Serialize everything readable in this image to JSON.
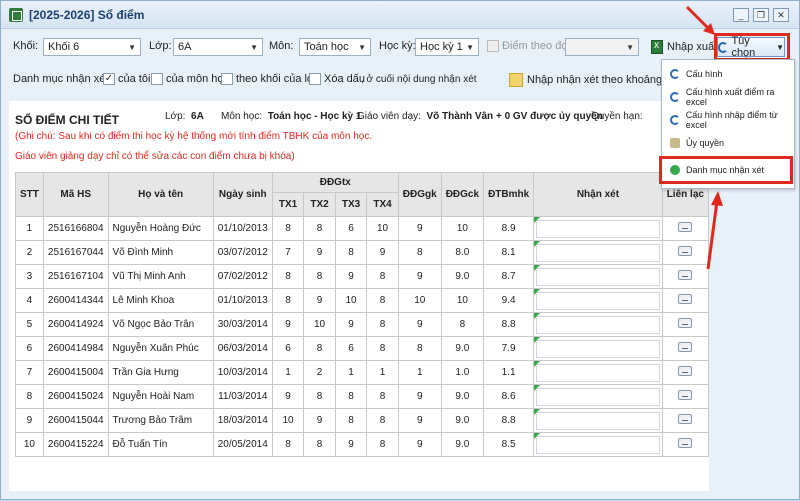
{
  "window": {
    "title": "[2025-2026] Sổ điểm"
  },
  "filters": {
    "khoi_label": "Khối:",
    "khoi_value": "Khối 6",
    "lop_label": "Lớp:",
    "lop_value": "6A",
    "mon_label": "Môn:",
    "mon_value": "Toán học",
    "hocky_label": "Học kỳ:",
    "hocky_value": "Học kỳ 1",
    "diem_theo_dot_label": "Điểm theo đợt",
    "nhap_xuat_label": "Nhập xuất",
    "tuy_chon_label": "Tùy chọn"
  },
  "comment_bar": {
    "label": "Danh mục nhận xét:",
    "cua_toi": "của tôi",
    "cua_mon_hoc": "của môn học",
    "theo_khoi": "theo khối của lớp",
    "xoa_dau": "Xóa dấu",
    "suffix": ", ở cuối nội dung nhận xét",
    "nhap_nx_button": "Nhập nhận xét theo khoảng điểm"
  },
  "dropdown": {
    "items": [
      "Cấu hình",
      "Cấu hình xuất điểm ra excel",
      "Cấu hình nhập điểm từ excel",
      "Ủy quyền",
      "Danh mục nhận xét"
    ]
  },
  "detail": {
    "title": "SỔ ĐIỂM CHI TIẾT",
    "lop_label": "Lớp:",
    "lop_value": "6A",
    "mon_label": "Môn học:",
    "mon_value": "Toán học - Học kỳ 1",
    "gv_label": "Giáo viên dạy:",
    "gv_value": "Võ Thành Vân + 0 GV được ủy quyền",
    "quyen_han_label": "Quyền hạn:",
    "note1": "(Ghi chú: Sau khi có điểm thi học kỳ hệ thống mới tính điểm TBHK của môn học.",
    "note2": "Giáo viên giảng dạy chỉ có thể sửa các con điểm chưa bị khóa)"
  },
  "table": {
    "headers": {
      "stt": "STT",
      "ma_hs": "Mã HS",
      "ho_ten": "Họ và tên",
      "ngay_sinh": "Ngày sinh",
      "ddgtx": "ĐĐGtx",
      "tx1": "TX1",
      "tx2": "TX2",
      "tx3": "TX3",
      "tx4": "TX4",
      "ddggk": "ĐĐGgk",
      "ddgck": "ĐĐGck",
      "dtbmhk": "ĐTBmhk",
      "nhan_xet": "Nhận xét",
      "lien_lac": "Liên lạc"
    },
    "rows": [
      [
        "1",
        "2516166804",
        "Nguyễn Hoàng Đức",
        "01/10/2013",
        "8",
        "8",
        "6",
        "10",
        "9",
        "10",
        "8.9"
      ],
      [
        "2",
        "2516167044",
        "Võ Đình Minh",
        "03/07/2012",
        "7",
        "9",
        "8",
        "9",
        "8",
        "8.0",
        "8.1"
      ],
      [
        "3",
        "2516167104",
        "Vũ Thị Minh  Anh",
        "07/02/2012",
        "8",
        "8",
        "9",
        "8",
        "9",
        "9.0",
        "8.7"
      ],
      [
        "4",
        "2600414344",
        "Lê Minh Khoa",
        "01/10/2013",
        "8",
        "9",
        "10",
        "8",
        "10",
        "10",
        "9.4"
      ],
      [
        "5",
        "2600414924",
        "Võ Ngọc Bảo Trân",
        "30/03/2014",
        "9",
        "10",
        "9",
        "8",
        "9",
        "8",
        "8.8"
      ],
      [
        "6",
        "2600414984",
        "Nguyễn Xuân Phúc",
        "06/03/2014",
        "6",
        "8",
        "6",
        "8",
        "8",
        "9.0",
        "7.9"
      ],
      [
        "7",
        "2600415004",
        "Trần Gia Hưng",
        "10/03/2014",
        "1",
        "2",
        "1",
        "1",
        "1",
        "1.0",
        "1.1"
      ],
      [
        "8",
        "2600415024",
        "Nguyễn Hoài Nam",
        "11/03/2014",
        "9",
        "8",
        "8",
        "8",
        "9",
        "9.0",
        "8.6"
      ],
      [
        "9",
        "2600415044",
        "Trương Bảo Trâm",
        "18/03/2014",
        "10",
        "9",
        "8",
        "8",
        "9",
        "9.0",
        "8.8"
      ],
      [
        "10",
        "2600415224",
        "Đỗ Tuấn Tín",
        "20/05/2014",
        "8",
        "8",
        "9",
        "8",
        "9",
        "9.0",
        "8.5"
      ]
    ]
  },
  "colors": {
    "highlight_red": "#e0281e",
    "note_red": "#e0281e",
    "title_blue": "#1b3f73"
  }
}
